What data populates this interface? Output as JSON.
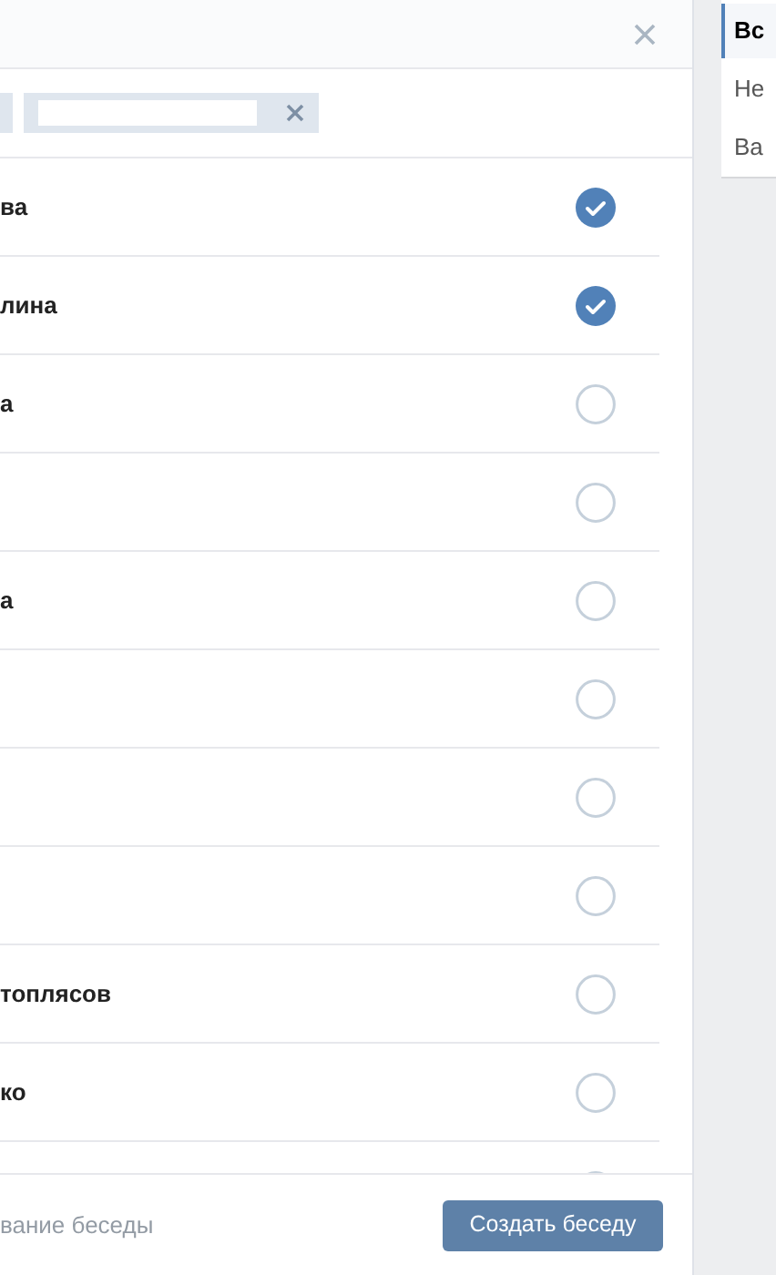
{
  "chips": [
    {
      "kind": "partial"
    },
    {
      "kind": "redacted"
    }
  ],
  "friends": [
    {
      "name": "ва",
      "selected": true
    },
    {
      "name": "лина",
      "selected": true
    },
    {
      "name": "а",
      "selected": false
    },
    {
      "selected": false
    },
    {
      "name": "а",
      "selected": false
    },
    {
      "selected": false
    },
    {
      "selected": false
    },
    {
      "selected": false
    },
    {
      "name": "топлясов",
      "selected": false
    },
    {
      "name": "ко",
      "selected": false
    },
    {
      "selected": false
    }
  ],
  "footer": {
    "placeholder": "вание беседы",
    "button": "Создать беседу"
  },
  "side_menu": [
    {
      "label": "Вс",
      "selected": true
    },
    {
      "label": "Не",
      "selected": false
    },
    {
      "label": "Ва",
      "selected": false
    }
  ]
}
